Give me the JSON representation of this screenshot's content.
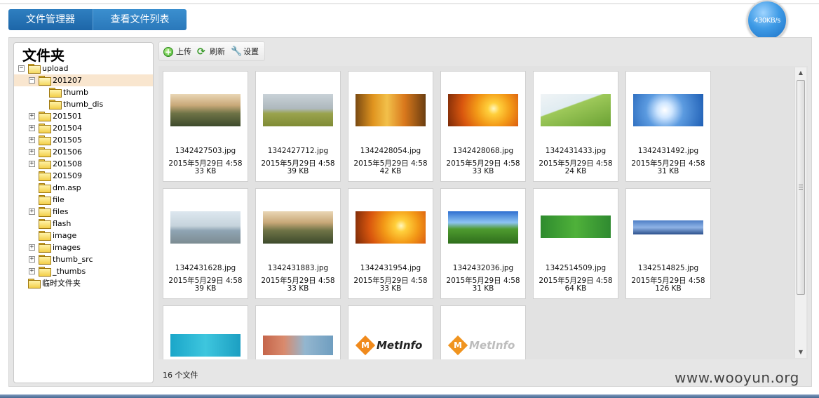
{
  "tabs": [
    {
      "label": "文件管理器",
      "active": true
    },
    {
      "label": "查看文件列表",
      "active": false
    }
  ],
  "speed_indicator": "430KB/s",
  "sidebar": {
    "title": "文件夹",
    "tree": [
      {
        "label": "upload",
        "expander": "minus",
        "open": true,
        "indent": 0
      },
      {
        "label": "201207",
        "expander": "minus",
        "open": true,
        "indent": 1,
        "selected": true
      },
      {
        "label": "thumb",
        "expander": "none",
        "indent": 2
      },
      {
        "label": "thumb_dis",
        "expander": "none",
        "indent": 2
      },
      {
        "label": "201501",
        "expander": "plus",
        "indent": 1
      },
      {
        "label": "201504",
        "expander": "plus",
        "indent": 1
      },
      {
        "label": "201505",
        "expander": "plus",
        "indent": 1
      },
      {
        "label": "201506",
        "expander": "plus",
        "indent": 1
      },
      {
        "label": "201508",
        "expander": "plus",
        "indent": 1
      },
      {
        "label": "201509",
        "expander": "none",
        "indent": 1
      },
      {
        "label": "dm.asp",
        "expander": "none",
        "indent": 1
      },
      {
        "label": "file",
        "expander": "none",
        "indent": 1
      },
      {
        "label": "files",
        "expander": "plus",
        "indent": 1
      },
      {
        "label": "flash",
        "expander": "none",
        "indent": 1
      },
      {
        "label": "image",
        "expander": "none",
        "indent": 1
      },
      {
        "label": "images",
        "expander": "plus",
        "indent": 1
      },
      {
        "label": "thumb_src",
        "expander": "plus",
        "indent": 1
      },
      {
        "label": "_thumbs",
        "expander": "plus",
        "indent": 1
      },
      {
        "label": "临时文件夹",
        "expander": "none",
        "indent": 0
      }
    ]
  },
  "toolbar": {
    "upload_label": "上传",
    "refresh_label": "刷新",
    "settings_label": "设置"
  },
  "files": [
    {
      "name": "1342427503.jpg",
      "date": "2015年5月29日 4:58",
      "size": "33 KB",
      "thumb": "mountain-village"
    },
    {
      "name": "1342427712.jpg",
      "date": "2015年5月29日 4:58",
      "size": "39 KB",
      "thumb": "bicycle-field"
    },
    {
      "name": "1342428054.jpg",
      "date": "2015年5月29日 4:58",
      "size": "42 KB",
      "thumb": "autumn-trees"
    },
    {
      "name": "1342428068.jpg",
      "date": "2015年5月29日 4:58",
      "size": "33 KB",
      "thumb": "sunset-sea"
    },
    {
      "name": "1342431433.jpg",
      "date": "2015年5月29日 4:58",
      "size": "24 KB",
      "thumb": "green-hill"
    },
    {
      "name": "1342431492.jpg",
      "date": "2015年5月29日 4:58",
      "size": "31 KB",
      "thumb": "blue-sky-plane"
    },
    {
      "name": "1342431628.jpg",
      "date": "2015年5月29日 4:58",
      "size": "39 KB",
      "thumb": "pagoda-lake"
    },
    {
      "name": "1342431883.jpg",
      "date": "2015年5月29日 4:58",
      "size": "33 KB",
      "thumb": "mountain-village"
    },
    {
      "name": "1342431954.jpg",
      "date": "2015年5月29日 4:58",
      "size": "33 KB",
      "thumb": "sunset-sea"
    },
    {
      "name": "1342432036.jpg",
      "date": "2015年5月29日 4:58",
      "size": "31 KB",
      "thumb": "green-valley"
    },
    {
      "name": "1342514509.jpg",
      "date": "2015年5月29日 4:58",
      "size": "64 KB",
      "thumb": "green-banner"
    },
    {
      "name": "1342514825.jpg",
      "date": "2015年5月29日 4:58",
      "size": "126 KB",
      "thumb": "city-night"
    },
    {
      "name": "",
      "date": "",
      "size": "",
      "thumb": "cyan-banner"
    },
    {
      "name": "",
      "date": "",
      "size": "",
      "thumb": "buildings"
    },
    {
      "name": "",
      "date": "",
      "size": "",
      "thumb": "metinfo-logo-color",
      "logo_text": "MetInfo"
    },
    {
      "name": "",
      "date": "",
      "size": "",
      "thumb": "metinfo-logo-grey",
      "logo_text": "MetInfo"
    }
  ],
  "status": {
    "file_count": "16 个文件"
  },
  "watermark": "www.wooyun.org",
  "colors": {
    "tab_active": "#1d66a8",
    "tab_normal": "#2a78ba",
    "selected_row": "#f9e6cf",
    "panel_bg": "#e6e6e6",
    "logo_orange": "#f08a1c"
  }
}
